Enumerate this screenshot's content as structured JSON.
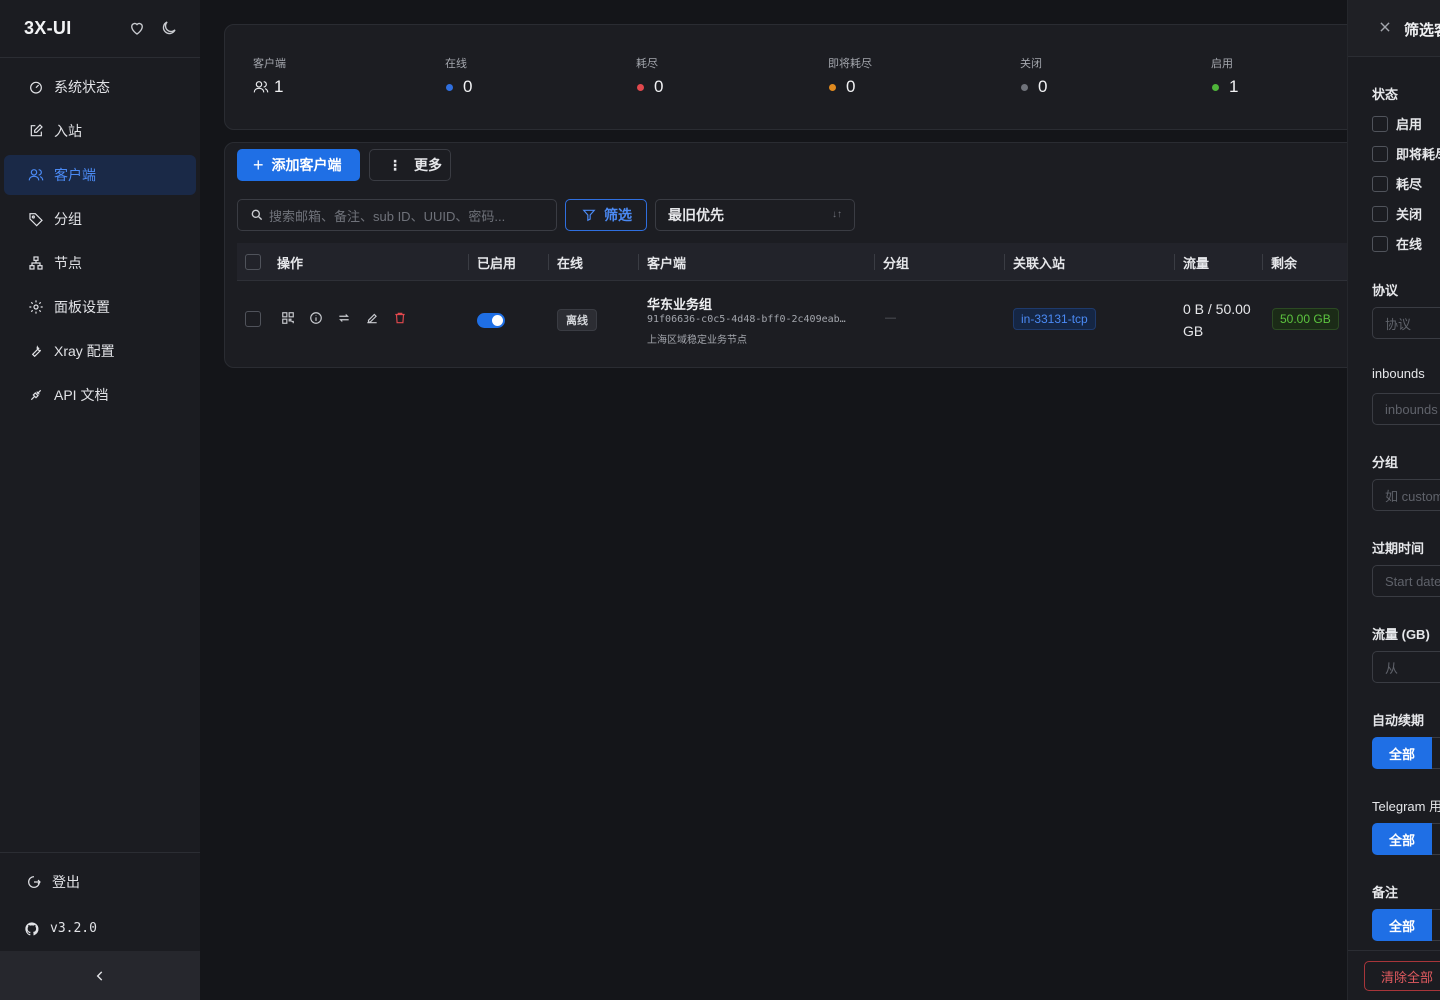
{
  "app": {
    "title": "3X-UI",
    "accent_color": "#1f6fe5",
    "icons": [
      "heart-icon",
      "moon-icon"
    ]
  },
  "sidebar": {
    "items": [
      {
        "label": "系统状态",
        "icon": "dashboard-icon",
        "active": false
      },
      {
        "label": "入站",
        "icon": "edit-square-icon",
        "active": false
      },
      {
        "label": "客户端",
        "icon": "users-icon",
        "active": true
      },
      {
        "label": "分组",
        "icon": "tag-icon",
        "active": false
      },
      {
        "label": "节点",
        "icon": "cluster-icon",
        "active": false
      },
      {
        "label": "面板设置",
        "icon": "gear-icon",
        "active": false
      },
      {
        "label": "Xray 配置",
        "icon": "tool-icon",
        "active": false
      },
      {
        "label": "API 文档",
        "icon": "api-icon",
        "active": false
      }
    ],
    "logout_label": "登出",
    "version": "v3.2.0"
  },
  "stats": [
    {
      "label": "客户端",
      "value": "1",
      "icon": "users-icon"
    },
    {
      "label": "在线",
      "value": "0",
      "color": "#2f6fdf"
    },
    {
      "label": "耗尽",
      "value": "0",
      "color": "#e0484d"
    },
    {
      "label": "即将耗尽",
      "value": "0",
      "color": "#e08a1f"
    },
    {
      "label": "关闭",
      "value": "0",
      "color": "#6f727a"
    },
    {
      "label": "启用",
      "value": "1",
      "color": "#4fb43a"
    }
  ],
  "toolbar": {
    "add_client_label": "添加客户端",
    "more_label": "更多",
    "search_placeholder": "搜索邮箱、备注、sub ID、UUID、密码...",
    "filter_label": "筛选",
    "sort_value": "最旧优先"
  },
  "table": {
    "headers": [
      "操作",
      "已启用",
      "在线",
      "客户端",
      "分组",
      "关联入站",
      "流量",
      "剩余"
    ],
    "rows": [
      {
        "enabled": true,
        "online": "离线",
        "client_name": "华东业务组",
        "client_id": "91f06636-c0c5-4d48-bff0-2c409eab…",
        "client_note": "上海区域稳定业务节点",
        "group": "—",
        "inbound": "in-33131-tcp",
        "traffic": "0 B / 50.00 GB",
        "remaining": "50.00 GB"
      }
    ]
  },
  "drawer": {
    "title": "筛选客户端",
    "status_label": "状态",
    "status_options": [
      "启用",
      "即将耗尽",
      "耗尽",
      "关闭",
      "在线"
    ],
    "protocol_label": "协议",
    "protocol_placeholder": "协议",
    "inbounds_label": "inbounds",
    "inbounds_placeholder": "inbounds",
    "group_label": "分组",
    "group_placeholder": "如 customer",
    "expiry_label": "过期时间",
    "expiry_placeholder": "Start date",
    "traffic_label": "流量 (GB)",
    "traffic_placeholder": "从",
    "auto_renew_label": "自动续期",
    "auto_renew_value": "全部",
    "telegram_label": "Telegram 用户",
    "telegram_value": "全部",
    "note_label": "备注",
    "note_value": "全部",
    "clear_label": "清除全部"
  }
}
